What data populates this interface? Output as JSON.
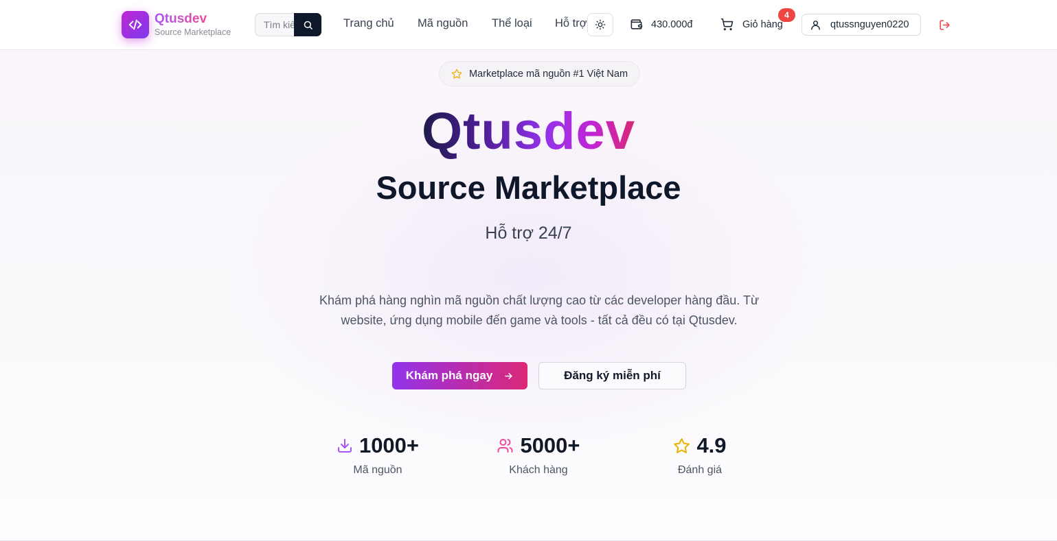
{
  "header": {
    "brand_name": "Qtusdev",
    "brand_tagline": "Source Marketplace",
    "search": {
      "placeholder": "Tìm kiếm mã nguồn...",
      "value": ""
    },
    "nav": [
      {
        "label": "Trang chủ"
      },
      {
        "label": "Mã nguồn"
      },
      {
        "label": "Thể loại"
      },
      {
        "label": "Hỗ trợ"
      }
    ],
    "wallet_balance": "430.000đ",
    "cart": {
      "label": "Giỏ hàng",
      "count": "4"
    },
    "username": "qtussnguyen0220"
  },
  "hero": {
    "badge": "Marketplace mã nguồn #1 Việt Nam",
    "title": "Qtusdev",
    "subtitle": "Source Marketplace",
    "tagline": "Hỗ trợ 24/7",
    "description_line1": "Khám phá hàng nghìn mã nguồn chất lượng cao từ các developer hàng đầu. Từ",
    "description_line2": "website, ứng dụng mobile đến game và tools - tất cả đều có tại Qtusdev.",
    "primary_cta": "Khám phá ngay",
    "secondary_cta": "Đăng ký miễn phí"
  },
  "stats": [
    {
      "value": "1000+",
      "label": "Mã nguồn",
      "icon": "download-icon"
    },
    {
      "value": "5000+",
      "label": "Khách hàng",
      "icon": "users-icon"
    },
    {
      "value": "4.9",
      "label": "Đánh giá",
      "icon": "star-icon"
    }
  ],
  "colors": {
    "accent_start": "#9333ea",
    "accent_end": "#db2777",
    "badge_red": "#ef4444",
    "logout_red": "#ef4444",
    "star_yellow": "#eab308"
  }
}
